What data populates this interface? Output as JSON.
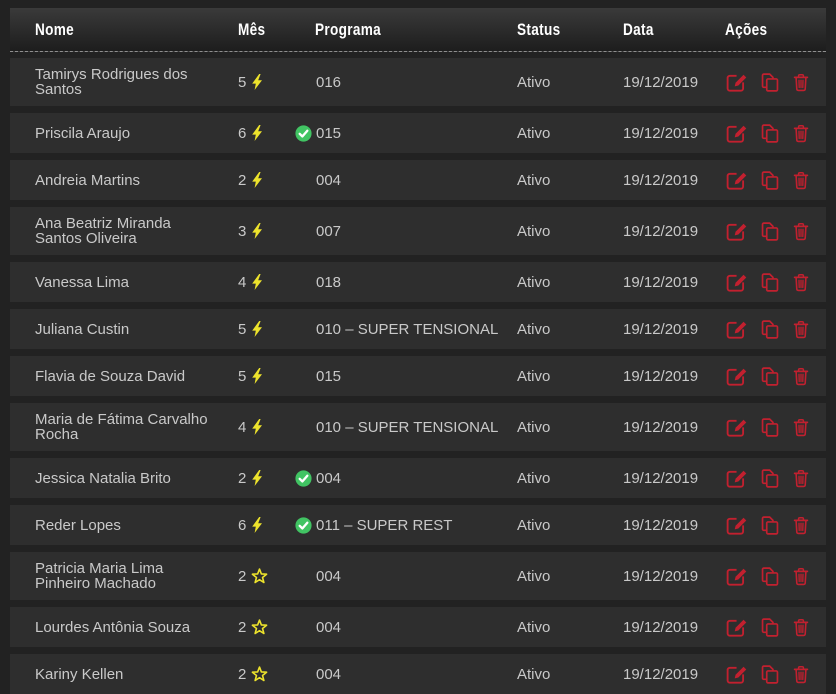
{
  "table": {
    "header": {
      "nome": "Nome",
      "mes": "Mês",
      "programa": "Programa",
      "status": "Status",
      "data": "Data",
      "acoes": "Ações"
    },
    "rows": [
      {
        "nome": "Tamirys Rodrigues dos Santos",
        "mes": "5",
        "mes_icon": "bolt-icon",
        "check": false,
        "programa": "016",
        "status": "Ativo",
        "data": "19/12/2019"
      },
      {
        "nome": "Priscila Araujo",
        "mes": "6",
        "mes_icon": "bolt-icon",
        "check": true,
        "programa": "015",
        "status": "Ativo",
        "data": "19/12/2019"
      },
      {
        "nome": "Andreia Martins",
        "mes": "2",
        "mes_icon": "bolt-icon",
        "check": false,
        "programa": "004",
        "status": "Ativo",
        "data": "19/12/2019"
      },
      {
        "nome": "Ana Beatriz Miranda Santos Oliveira",
        "mes": "3",
        "mes_icon": "bolt-icon",
        "check": false,
        "programa": "007",
        "status": "Ativo",
        "data": "19/12/2019"
      },
      {
        "nome": "Vanessa Lima",
        "mes": "4",
        "mes_icon": "bolt-icon",
        "check": false,
        "programa": "018",
        "status": "Ativo",
        "data": "19/12/2019"
      },
      {
        "nome": "Juliana Custin",
        "mes": "5",
        "mes_icon": "bolt-icon",
        "check": false,
        "programa": "010 – SUPER TENSIONAL",
        "status": "Ativo",
        "data": "19/12/2019"
      },
      {
        "nome": "Flavia de Souza David",
        "mes": "5",
        "mes_icon": "bolt-icon",
        "check": false,
        "programa": "015",
        "status": "Ativo",
        "data": "19/12/2019"
      },
      {
        "nome": "Maria de Fátima Carvalho Rocha",
        "mes": "4",
        "mes_icon": "bolt-icon",
        "check": false,
        "programa": "010 – SUPER TENSIONAL",
        "status": "Ativo",
        "data": "19/12/2019"
      },
      {
        "nome": "Jessica Natalia Brito",
        "mes": "2",
        "mes_icon": "bolt-icon",
        "check": true,
        "programa": "004",
        "status": "Ativo",
        "data": "19/12/2019"
      },
      {
        "nome": "Reder Lopes",
        "mes": "6",
        "mes_icon": "bolt-icon",
        "check": true,
        "programa": "011 – SUPER REST",
        "status": "Ativo",
        "data": "19/12/2019"
      },
      {
        "nome": "Patricia Maria Lima Pinheiro Machado",
        "mes": "2",
        "mes_icon": "star-icon",
        "check": false,
        "programa": "004",
        "status": "Ativo",
        "data": "19/12/2019"
      },
      {
        "nome": "Lourdes Antônia Souza",
        "mes": "2",
        "mes_icon": "star-icon",
        "check": false,
        "programa": "004",
        "status": "Ativo",
        "data": "19/12/2019"
      },
      {
        "nome": "Kariny Kellen",
        "mes": "2",
        "mes_icon": "star-icon",
        "check": false,
        "programa": "004",
        "status": "Ativo",
        "data": "19/12/2019"
      }
    ],
    "row_actions": [
      {
        "name": "edit",
        "icon": "edit-icon"
      },
      {
        "name": "duplicate",
        "icon": "copy-icon"
      },
      {
        "name": "delete",
        "icon": "trash-icon"
      }
    ],
    "colors": {
      "page_bg": "#222222",
      "row_bg": "#2e2e2e",
      "header_text": "#ffffff",
      "body_text": "#c9c9c9",
      "action_red": "#c2202f",
      "bolt_yellow": "#ede32c",
      "check_green": "#41c463"
    }
  }
}
